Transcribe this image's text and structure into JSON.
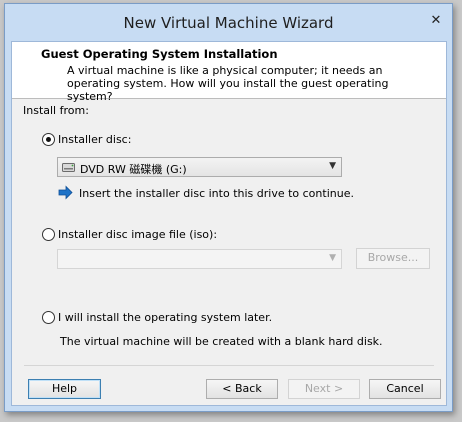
{
  "window": {
    "title": "New Virtual Machine Wizard",
    "close_glyph": "✕"
  },
  "header": {
    "title": "Guest Operating System Installation",
    "description": "A virtual machine is like a physical computer; it needs an operating system. How will you install the guest operating system?"
  },
  "install_from_label": "Install from:",
  "options": {
    "installer_disc": {
      "label": "Installer disc:",
      "selected": true,
      "drive_value": "DVD RW 磁碟機 (G:)",
      "info_text": "Insert the installer disc into this drive to continue."
    },
    "iso": {
      "label": "Installer disc image file (iso):",
      "selected": false,
      "path_value": "",
      "browse_label": "Browse..."
    },
    "later": {
      "label": "I will install the operating system later.",
      "selected": false,
      "description": "The virtual machine will be created with a blank hard disk."
    }
  },
  "buttons": {
    "help": "Help",
    "back": "< Back",
    "next": "Next >",
    "cancel": "Cancel"
  },
  "colors": {
    "accent": "#3c7fb1",
    "info_arrow": "#1e73c8"
  }
}
